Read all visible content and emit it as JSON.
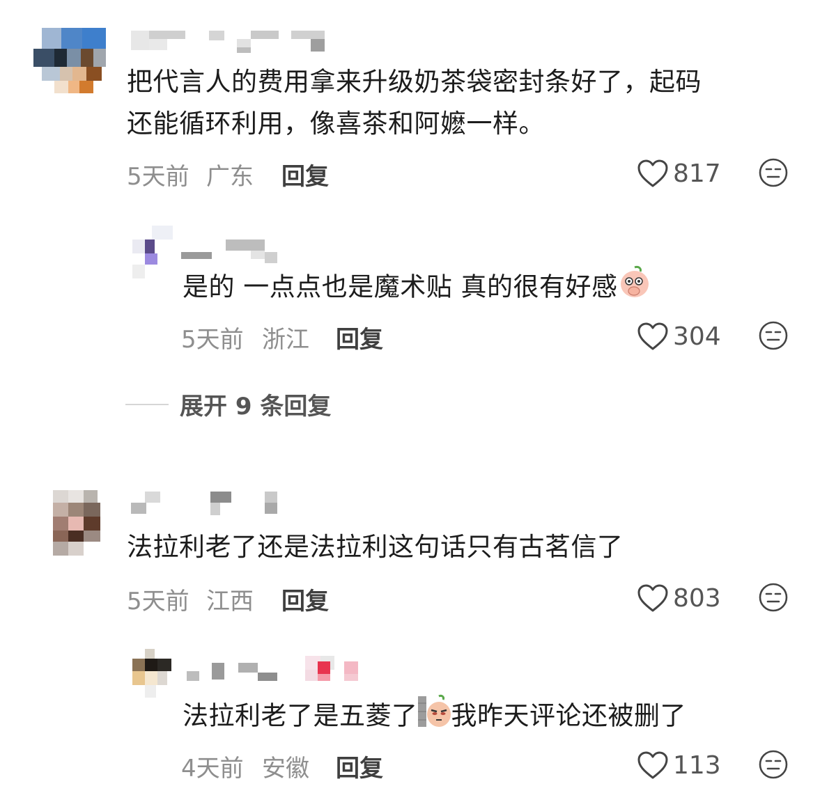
{
  "comments": [
    {
      "text_line1": "把代言人的费用拿来升级奶茶袋密封条好了，起码",
      "text_line2": "还能循环利用，像喜茶和阿嬷一样。",
      "time": "5天前",
      "region": "广东",
      "reply_label": "回复",
      "likes": "817",
      "replies": [
        {
          "text": "是的 一点点也是魔术贴 真的很有好感",
          "emoji": "peach-covering-mouth-emoji",
          "time": "5天前",
          "region": "浙江",
          "reply_label": "回复",
          "likes": "304"
        }
      ],
      "expand_label": "展开 9 条回复"
    },
    {
      "text_line1": "法拉利老了还是法拉利这句话只有古茗信了",
      "time": "5天前",
      "region": "江西",
      "reply_label": "回复",
      "likes": "803",
      "replies": [
        {
          "text_before": "法拉利老了是五菱了",
          "emoji": "peach-peeking-emoji",
          "text_after": "我昨天评论还被删了",
          "time": "4天前",
          "region": "安徽",
          "reply_label": "回复",
          "likes": "113"
        }
      ]
    }
  ],
  "icons": {
    "like": "heart-outline-icon",
    "dislike": "meh-face-icon"
  },
  "colors": {
    "text": "#1c1c1c",
    "meta": "#8e8e8e",
    "reply": "#3f3f3f"
  }
}
